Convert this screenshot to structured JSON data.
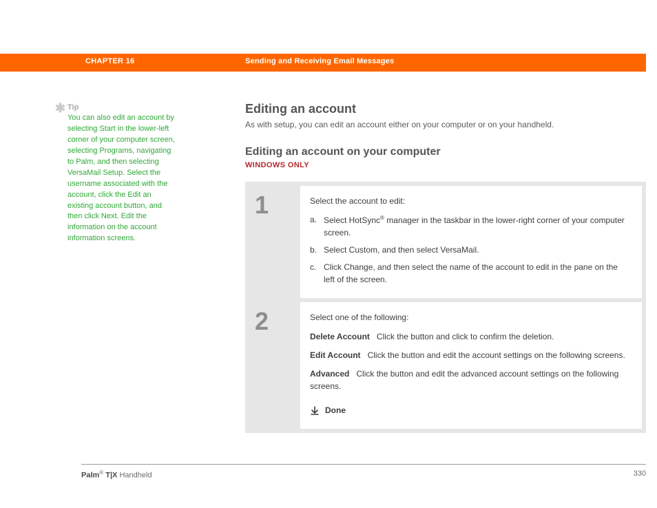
{
  "header": {
    "chapter_label": "CHAPTER 16",
    "chapter_title": "Sending and Receiving Email Messages"
  },
  "sidebar": {
    "tip_heading": "Tip",
    "tip_body": "You can also edit an account by selecting Start in the lower-left corner of your computer screen, selecting Programs, navigating to Palm, and then selecting VersaMail Setup. Select the username associated with the account, click the Edit an existing account button, and then click Next. Edit the information on the account information screens."
  },
  "main": {
    "h1": "Editing an account",
    "intro": "As with setup, you can edit an account either on your computer or on your handheld.",
    "h2": "Editing an account on your computer",
    "platform": "WINDOWS ONLY",
    "steps": [
      {
        "num": "1",
        "lead": "Select the account to edit:",
        "subs": [
          {
            "letter": "a.",
            "text_pre": "Select HotSync",
            "text_post": " manager in the taskbar in the lower-right corner of your computer screen."
          },
          {
            "letter": "b.",
            "text": "Select Custom, and then select VersaMail."
          },
          {
            "letter": "c.",
            "text": "Click Change, and then select the name of the account to edit in the pane on the left of the screen."
          }
        ]
      },
      {
        "num": "2",
        "lead": "Select one of the following:",
        "options": [
          {
            "label": "Delete Account",
            "desc": "Click the button and click to confirm the deletion."
          },
          {
            "label": "Edit Account",
            "desc": "Click the button and edit the account settings on the following screens."
          },
          {
            "label": "Advanced",
            "desc": "Click the button and edit the advanced account settings on the following screens."
          }
        ],
        "done": "Done"
      }
    ]
  },
  "footer": {
    "brand_pre": "Palm",
    "brand_post": " T|X",
    "brand_tail": " Handheld",
    "page": "330"
  },
  "glyphs": {
    "reg": "®"
  }
}
